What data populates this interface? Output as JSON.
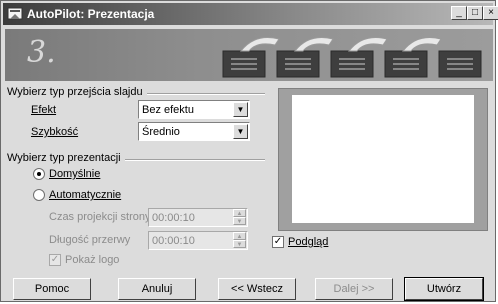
{
  "window": {
    "title": "AutoPilot: Prezentacja"
  },
  "titlebar": {
    "minimize": "_",
    "maximize": "□",
    "close": "×"
  },
  "banner": {
    "step": "3."
  },
  "transition": {
    "section_title": "Wybierz typ przejścia slajdu",
    "effect_label": "Efekt",
    "effect_value": "Bez efektu",
    "speed_label": "Szybkość",
    "speed_value": "Średnio"
  },
  "presentation": {
    "section_title": "Wybierz typ prezentacji",
    "default_label": "Domyślnie",
    "auto_label": "Automatycznie",
    "page_time_label": "Czas projekcji strony",
    "page_time_value": "00:00:10",
    "pause_label": "Długość przerwy",
    "pause_value": "00:00:10",
    "show_logo_label": "Pokaż logo"
  },
  "preview": {
    "label": "Podgląd"
  },
  "buttons": {
    "help": "Pomoc",
    "cancel": "Anuluj",
    "back": "<< Wstecz",
    "next": "Dalej >>",
    "create": "Utwórz"
  }
}
